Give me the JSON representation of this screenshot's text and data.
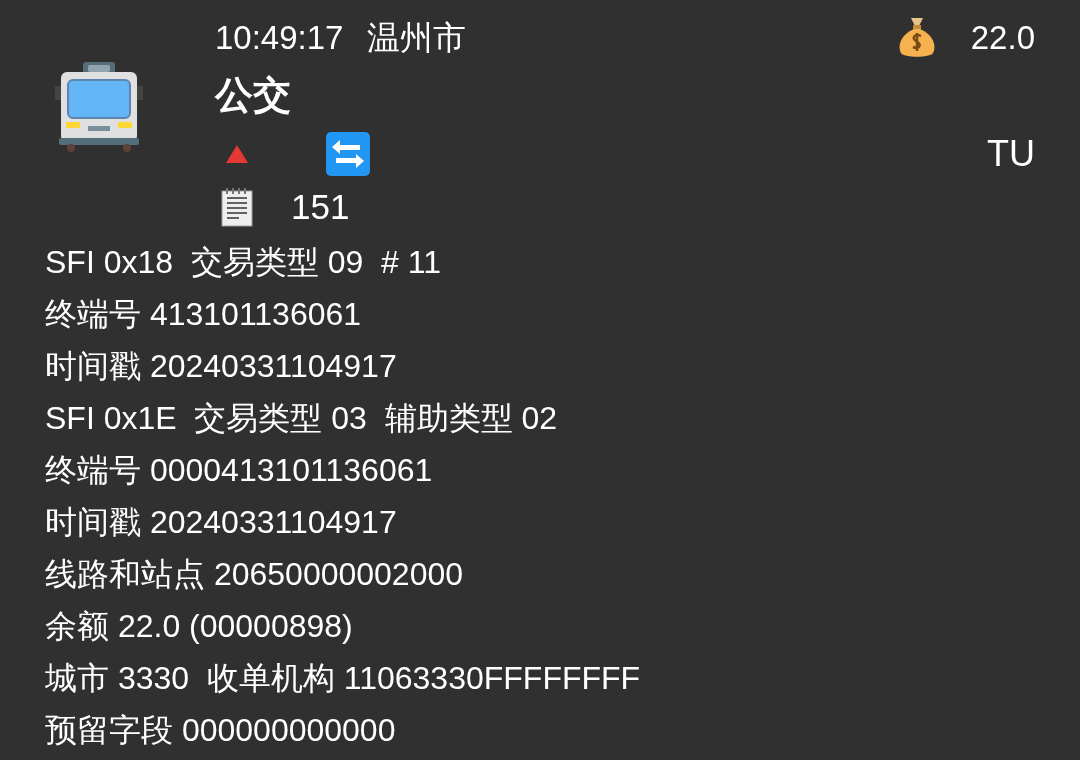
{
  "header": {
    "time": "10:49:17",
    "city": "温州市",
    "title": "公交",
    "balance": "22.0",
    "code": "TU",
    "record_count": "151"
  },
  "lines": [
    "SFI 0x18  交易类型 09  # 11",
    "终端号 413101136061",
    "时间戳 20240331104917",
    "SFI 0x1E  交易类型 03  辅助类型 02",
    "终端号 0000413101136061",
    "时间戳 20240331104917",
    "线路和站点 20650000002000",
    "余额 22.0 (00000898)",
    "城市 3330  收单机构 11063330FFFFFFFF",
    "预留字段 000000000000"
  ]
}
